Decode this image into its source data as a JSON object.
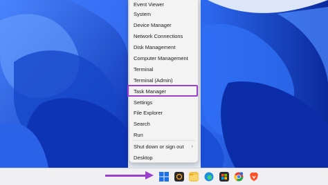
{
  "menu": {
    "items": [
      {
        "label": "Event Viewer"
      },
      {
        "label": "System"
      },
      {
        "label": "Device Manager"
      },
      {
        "label": "Network Connections"
      },
      {
        "label": "Disk Management"
      },
      {
        "label": "Computer Management"
      },
      {
        "label": "Terminal"
      },
      {
        "label": "Terminal (Admin)"
      },
      {
        "label": "Task Manager"
      },
      {
        "label": "Settings"
      },
      {
        "label": "File Explorer"
      },
      {
        "label": "Search"
      },
      {
        "label": "Run"
      },
      {
        "label": "Shut down or sign out"
      },
      {
        "label": "Desktop"
      }
    ],
    "highlighted_item": "Task Manager",
    "highlight_color": "#9b3fd1"
  },
  "taskbar": {
    "icons": [
      "windows-start-icon",
      "app-icon",
      "file-explorer-icon",
      "edge-icon",
      "store-icon",
      "chrome-icon",
      "brave-icon"
    ]
  },
  "colors": {
    "wallpaper_blue": "#1f5be0",
    "annotation_purple": "#9b3fd1"
  }
}
